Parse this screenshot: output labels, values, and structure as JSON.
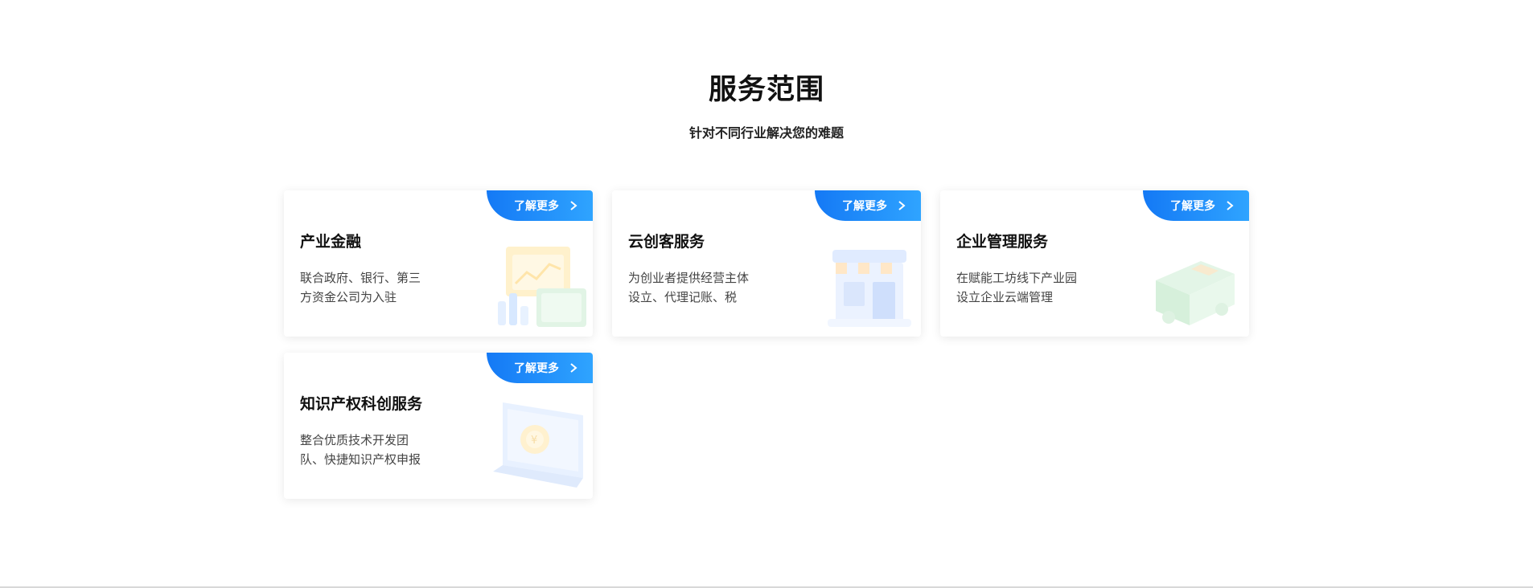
{
  "section": {
    "title": "服务范围",
    "subtitle": "针对不同行业解决您的难题"
  },
  "cards": [
    {
      "title": "产业金融",
      "desc_line1": "联合政府、银行、第三",
      "desc_line2": "方资金公司为入驻",
      "button_label": "了解更多",
      "illustration_icon": "finance-chart-illustration-icon"
    },
    {
      "title": "云创客服务",
      "desc_line1": "为创业者提供经营主体",
      "desc_line2": "设立、代理记账、税",
      "button_label": "了解更多",
      "illustration_icon": "storefront-illustration-icon"
    },
    {
      "title": "企业管理服务",
      "desc_line1": "在赋能工坊线下产业园",
      "desc_line2": "设立企业云端管理",
      "button_label": "了解更多",
      "illustration_icon": "delivery-truck-illustration-icon"
    },
    {
      "title": "知识产权科创服务",
      "desc_line1": "整合优质技术开发团",
      "desc_line2": "队、快捷知识产权申报",
      "button_label": "了解更多",
      "illustration_icon": "laptop-coin-illustration-icon"
    }
  ],
  "colors": {
    "accent_start": "#1479f5",
    "accent_end": "#2fa4ff",
    "title": "#111111",
    "desc": "#444444"
  }
}
